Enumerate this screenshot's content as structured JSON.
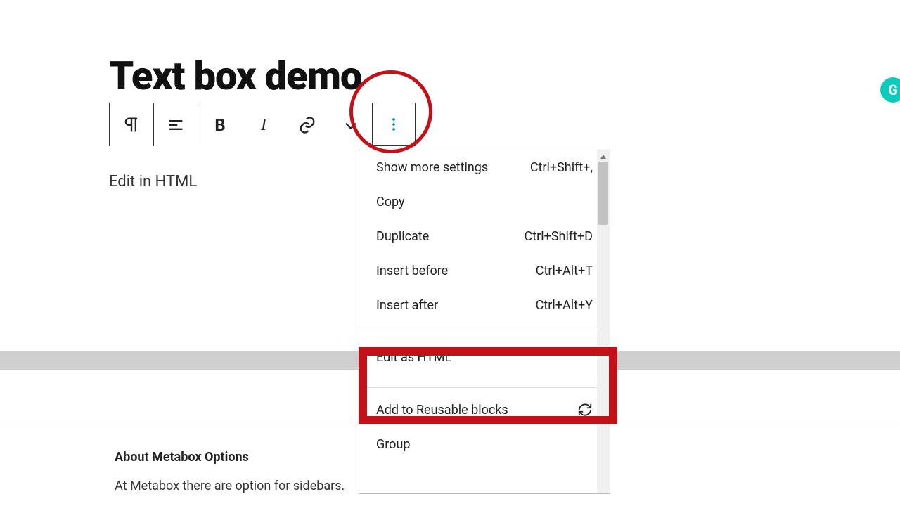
{
  "post": {
    "title": "Text box demo",
    "block_text": "Edit in HTML"
  },
  "toolbar": {
    "paragraph_icon": "paragraph",
    "align_icon": "align",
    "bold_label": "B",
    "italic_label": "I",
    "link_icon": "link",
    "dropdown_icon": "chevron-down",
    "more_icon": "more-vertical"
  },
  "menu": {
    "items": [
      {
        "label": "Show more settings",
        "shortcut": "Ctrl+Shift+,"
      },
      {
        "label": "Copy",
        "shortcut": ""
      },
      {
        "label": "Duplicate",
        "shortcut": "Ctrl+Shift+D"
      },
      {
        "label": "Insert before",
        "shortcut": "Ctrl+Alt+T"
      },
      {
        "label": "Insert after",
        "shortcut": "Ctrl+Alt+Y"
      }
    ],
    "edit_html": {
      "label": "Edit as HTML",
      "shortcut": ""
    },
    "reusable": {
      "label": "Add to Reusable blocks",
      "icon": "refresh"
    },
    "group": {
      "label": "Group",
      "shortcut": ""
    }
  },
  "metabox": {
    "title": "About Metabox Options",
    "desc": "At Metabox there are option for sidebars."
  },
  "badge": {
    "label": "G"
  },
  "colors": {
    "highlight": "#C3111A",
    "accent": "#0bcbbd"
  }
}
